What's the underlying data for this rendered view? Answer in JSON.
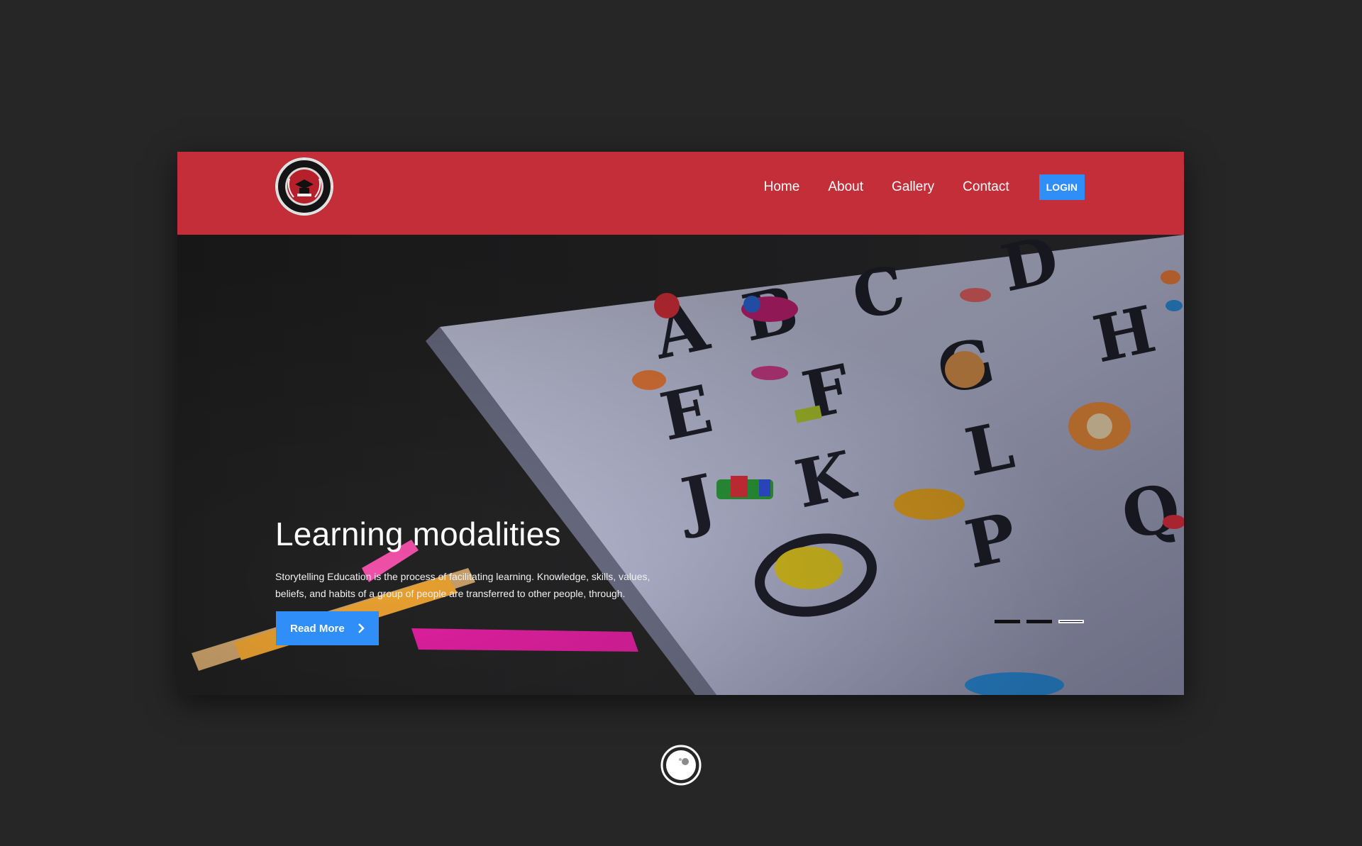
{
  "header": {
    "logo_icon": "school-crest-logo",
    "nav": [
      {
        "label": "Home"
      },
      {
        "label": "About"
      },
      {
        "label": "Gallery"
      },
      {
        "label": "Contact"
      }
    ],
    "login_label": "LOGIN"
  },
  "hero": {
    "title": "Learning modalities",
    "text": "Storytelling Education is the process of facilitating learning. Knowledge, skills, values, beliefs, and habits of a group of people are transferred to other people, through.",
    "cta_label": "Read More",
    "cta_icon": "chevron-right-icon",
    "slides_total": 3,
    "slide_active": 3
  },
  "colors": {
    "page_bg": "#262626",
    "header_bg": "#c32e38",
    "accent": "#2f8ef8"
  },
  "loader_icon": "loading-spinner-icon"
}
